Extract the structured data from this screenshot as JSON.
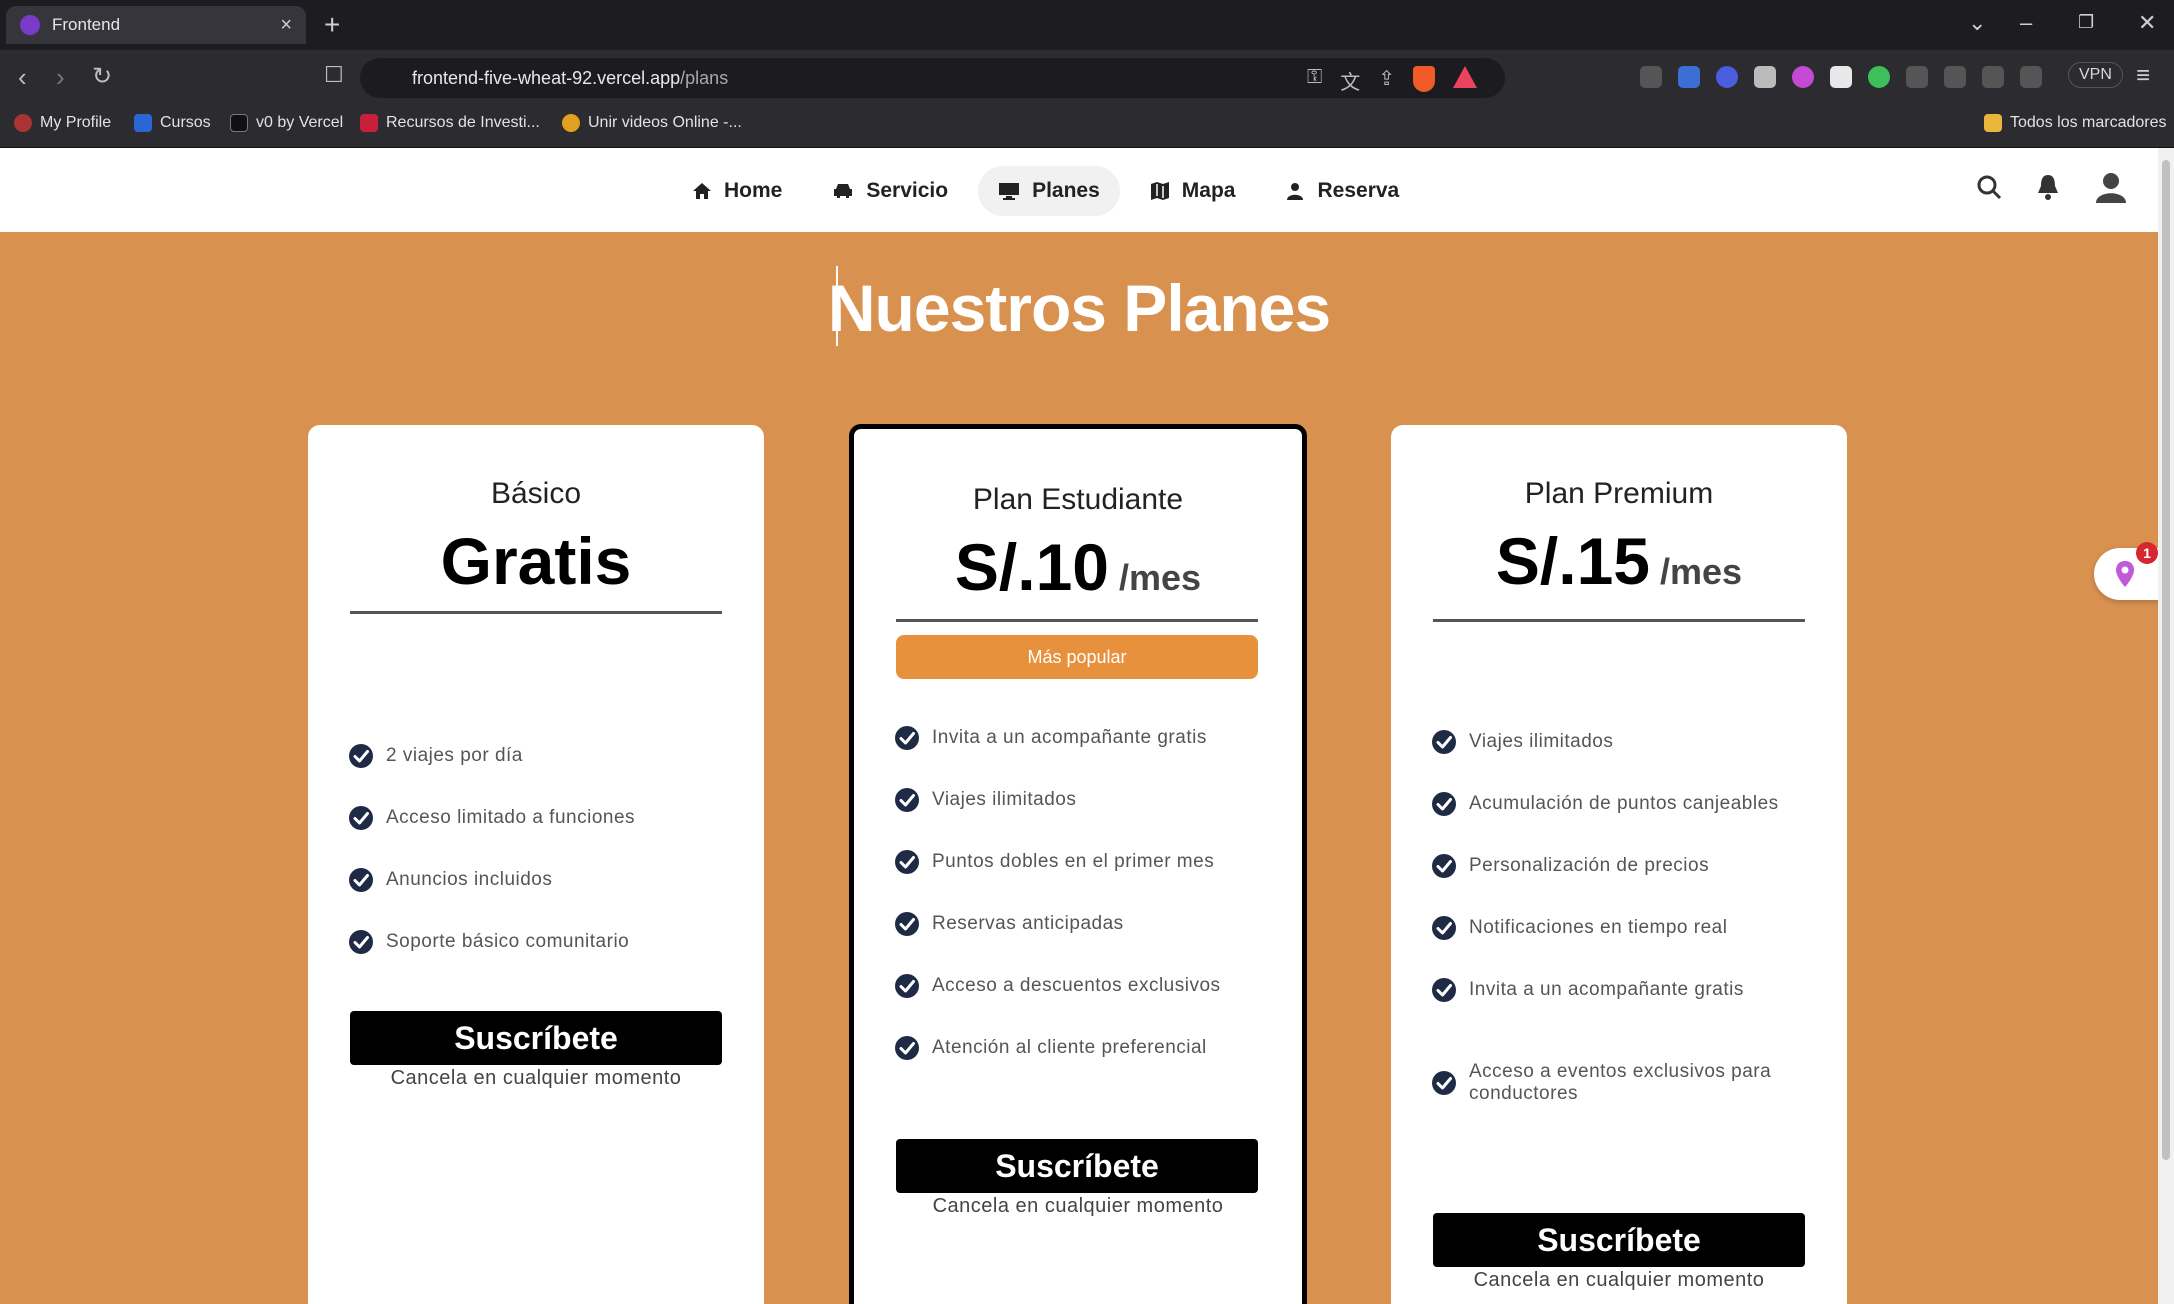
{
  "browser": {
    "tab_title": "Frontend",
    "url_host": "frontend-five-wheat-92.vercel.app",
    "url_path": "/plans",
    "vpn_label": "VPN",
    "bookmarks": [
      "My Profile",
      "Cursos",
      "v0 by Vercel",
      "Recursos de Investi...",
      "Unir videos Online -..."
    ],
    "bookmarks_folder": "Todos los marcadores"
  },
  "nav": {
    "items": [
      {
        "label": "Home",
        "icon": "home-icon"
      },
      {
        "label": "Servicio",
        "icon": "car-icon"
      },
      {
        "label": "Planes",
        "icon": "monitor-icon",
        "active": true
      },
      {
        "label": "Mapa",
        "icon": "map-icon"
      },
      {
        "label": "Reserva",
        "icon": "user-icon"
      }
    ]
  },
  "page": {
    "title": "Nuestros Planes"
  },
  "plans": [
    {
      "name": "Básico",
      "price": "Gratis",
      "per": "",
      "badge": "",
      "features": [
        "2 viajes por día",
        "Acceso limitado a funciones",
        "Anuncios incluidos",
        "Soporte básico comunitario"
      ],
      "cta": "Suscríbete",
      "note": "Cancela en cualquier momento"
    },
    {
      "name": "Plan Estudiante",
      "price": "S/.10",
      "per": "/mes",
      "badge": "Más popular",
      "features": [
        "Invita a un acompañante gratis",
        "Viajes ilimitados",
        "Puntos dobles en el primer mes",
        "Reservas anticipadas",
        "Acceso a descuentos exclusivos",
        "Atención al cliente preferencial"
      ],
      "cta": "Suscríbete",
      "note": "Cancela en cualquier momento"
    },
    {
      "name": "Plan Premium",
      "price": "S/.15",
      "per": "/mes",
      "badge": "",
      "features": [
        "Viajes ilimitados",
        "Acumulación de puntos canjeables",
        "Personalización de precios",
        "Notificaciones en tiempo real",
        "Invita a un acompañante gratis",
        "Acceso a eventos exclusivos para conductores"
      ],
      "cta": "Suscríbete",
      "note": "Cancela en cualquier momento"
    }
  ],
  "floating_badge": {
    "count": "1"
  },
  "colors": {
    "page_bg": "#d9914f",
    "badge": "#e8913d",
    "check": "#1f2a44"
  }
}
